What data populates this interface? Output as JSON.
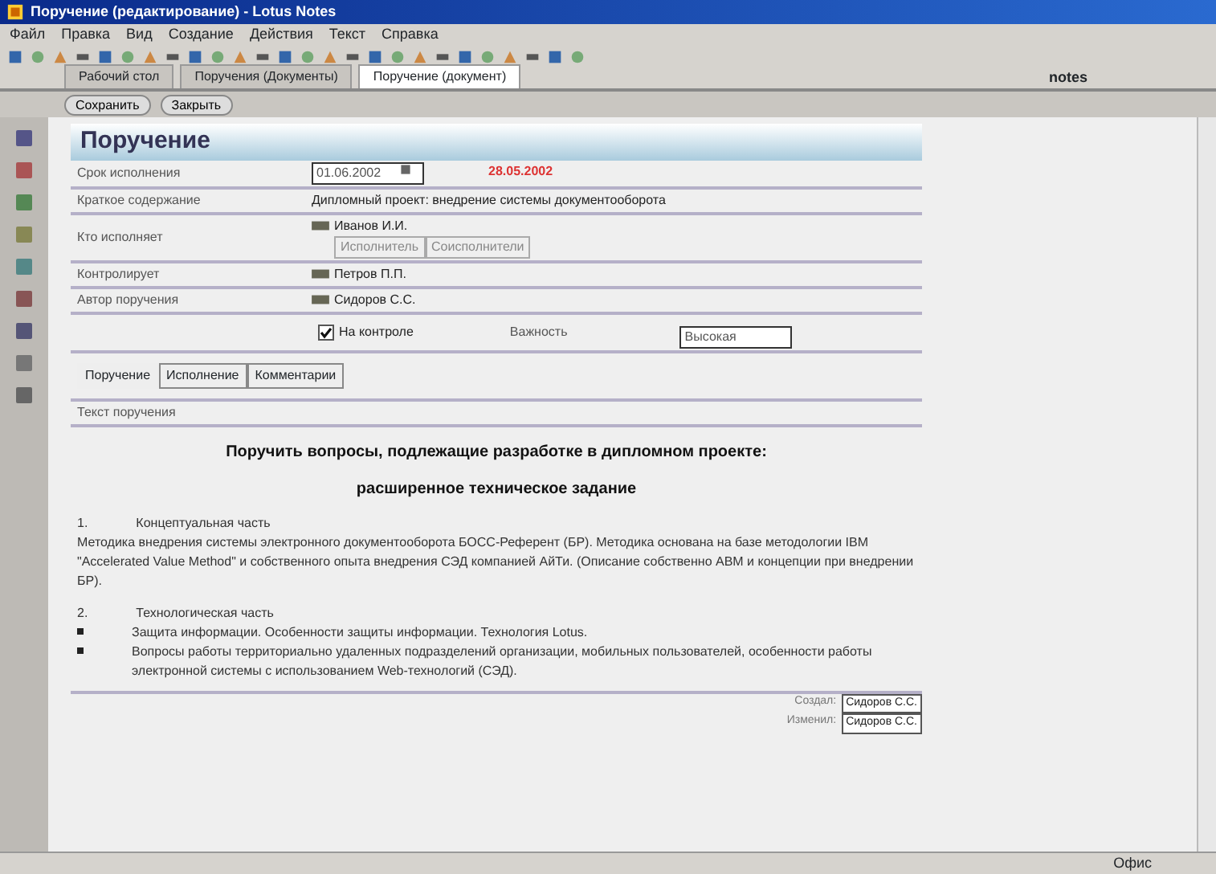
{
  "window": {
    "title": "Поручение (редактирование) - Lotus Notes"
  },
  "menu": [
    "Файл",
    "Правка",
    "Вид",
    "Создание",
    "Действия",
    "Текст",
    "Справка"
  ],
  "doc_tabs": [
    {
      "label": "Рабочий стол",
      "selected": false
    },
    {
      "label": "Поручения (Документы)",
      "selected": false
    },
    {
      "label": "Поручение (документ)",
      "selected": true
    }
  ],
  "brand": "notes",
  "actions": [
    {
      "label": "Сохранить"
    },
    {
      "label": "Закрыть"
    }
  ],
  "form": {
    "title": "Поручение",
    "fields": [
      {
        "kind": "date",
        "label": "Срок исполнения",
        "value": "01.06.2002",
        "note": "28.05.2002"
      },
      {
        "kind": "text",
        "label": "Краткое содержание",
        "value": "Дипломный проект: внедрение системы документооборота"
      },
      {
        "kind": "names",
        "label": "Кто исполняет",
        "value": "Иванов И.И.",
        "extra": [
          "Исполнитель",
          "Соисполнители"
        ]
      },
      {
        "kind": "names",
        "label": "Контролирует",
        "value": "Петров П.П."
      },
      {
        "kind": "names",
        "label": "Автор поручения",
        "value": "Сидоров С.С."
      }
    ],
    "control": {
      "label": "На контроле",
      "checked": true,
      "priority_label": "Важность",
      "priority": "Высокая"
    },
    "tabs": [
      {
        "label": "Поручение",
        "selected": true
      },
      {
        "label": "Исполнение",
        "selected": false
      },
      {
        "label": "Комментарии",
        "selected": false
      }
    ],
    "text_label": "Текст поручения",
    "body": [
      {
        "kind": "heading",
        "text": "Поручить вопросы, подлежащие разработке в дипломном проекте:"
      },
      {
        "kind": "heading",
        "text": "расширенное техническое задание"
      },
      {
        "kind": "numbered",
        "num": "1.",
        "text": "Концептуальная часть"
      },
      {
        "kind": "paragraph",
        "text": "Методика внедрения системы электронного документооборота БОСС-Референт (БР). Методика основана на базе методологии IBM \"Accelerated Value Method\" и собственного опыта внедрения СЭД компанией АйТи. (Описание собственно АВМ и концепции при внедрении БР)."
      },
      {
        "kind": "numbered",
        "num": "2.",
        "text": "Технологическая часть"
      },
      {
        "kind": "bullet",
        "text": "Защита информации. Особенности защиты информации. Технология Lotus."
      },
      {
        "kind": "bullet",
        "text": "Вопросы работы территориально удаленных подразделений организации, мобильных пользователей, особенности работы электронной системы с использованием Web-технологий (СЭД)."
      }
    ],
    "footer": [
      {
        "label": "Создал:",
        "value": "Сидоров С.С."
      },
      {
        "label": "Изменил:",
        "value": "Сидоров С.С."
      }
    ]
  },
  "status_bar": {
    "location": "Офис"
  }
}
